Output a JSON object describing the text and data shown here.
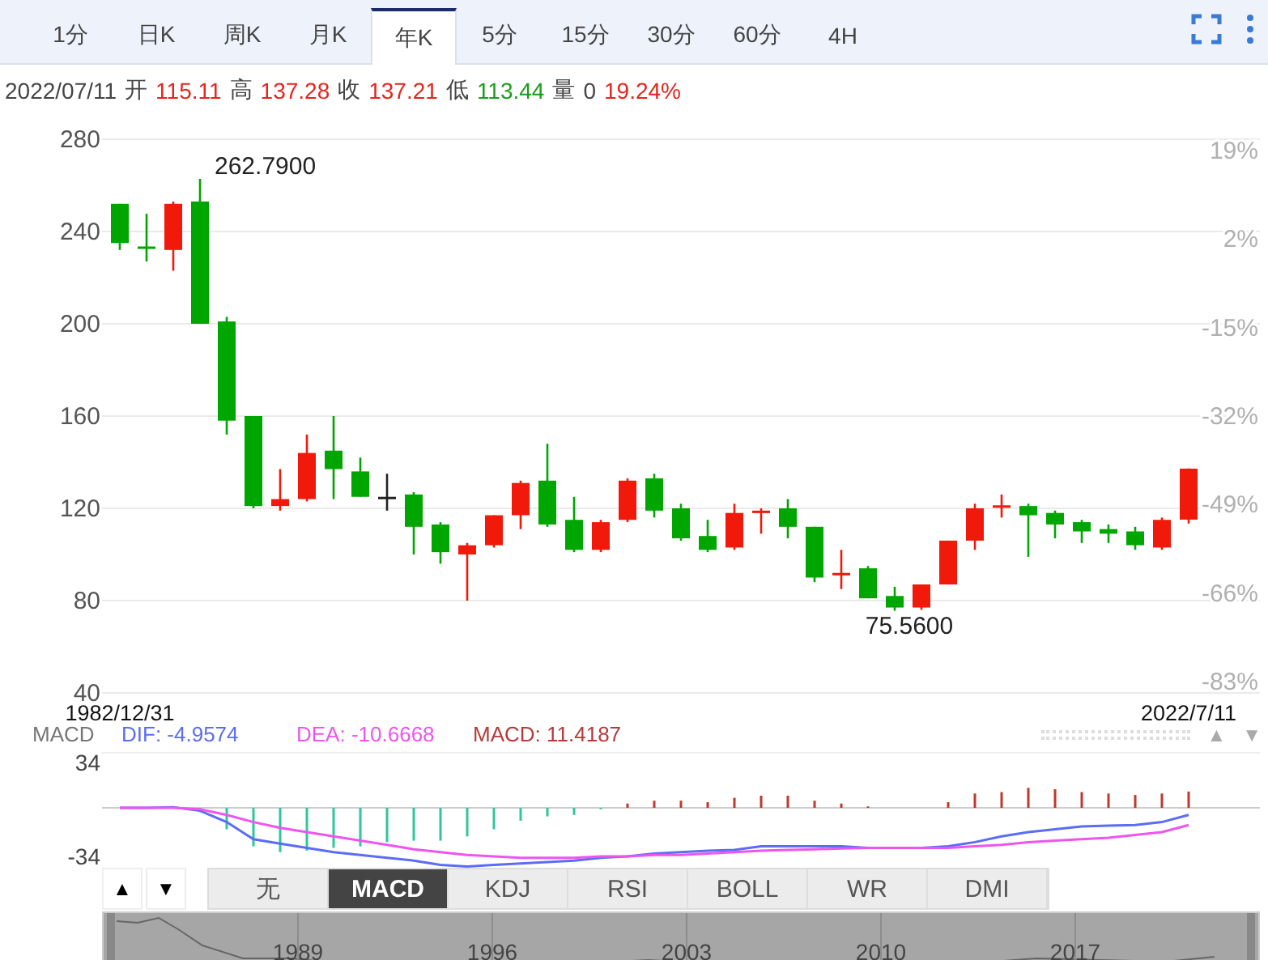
{
  "tabs": [
    {
      "label": "1分",
      "selected": false
    },
    {
      "label": "日K",
      "selected": false
    },
    {
      "label": "周K",
      "selected": false
    },
    {
      "label": "月K",
      "selected": false
    },
    {
      "label": "年K",
      "selected": true
    },
    {
      "label": "5分",
      "selected": false
    },
    {
      "label": "15分",
      "selected": false
    },
    {
      "label": "30分",
      "selected": false
    },
    {
      "label": "60分",
      "selected": false
    },
    {
      "label": "4H",
      "selected": false
    }
  ],
  "quote": {
    "date": "2022/07/11",
    "fields": [
      {
        "label": "开",
        "value": "115.11",
        "color": "#e8231b"
      },
      {
        "label": "高",
        "value": "137.28",
        "color": "#e8231b"
      },
      {
        "label": "收",
        "value": "137.21",
        "color": "#e8231b"
      },
      {
        "label": "低",
        "value": "113.44",
        "color": "#1a9e1a"
      },
      {
        "label": "量",
        "value": "0",
        "color": "#444444"
      }
    ],
    "change": {
      "value": "19.24%",
      "color": "#e8231b"
    }
  },
  "price_chart": {
    "right_axis": [
      "19%",
      "2%",
      "-15%",
      "-32%",
      "-49%",
      "-66%",
      "-83%"
    ],
    "chart_data": {
      "type": "candlestick",
      "categories": [
        "1982/12/31",
        null,
        null,
        null,
        null,
        null,
        null,
        null,
        null,
        null,
        null,
        null,
        null,
        null,
        null,
        null,
        null,
        null,
        null,
        null,
        null,
        null,
        null,
        null,
        null,
        null,
        null,
        null,
        null,
        null,
        null,
        null,
        null,
        null,
        null,
        null,
        null,
        null,
        null,
        null,
        "2022/7/11"
      ],
      "ohlc": [
        [
          252,
          252,
          232,
          235
        ],
        [
          233.5,
          247.7,
          227,
          233
        ],
        [
          232,
          253,
          223,
          252
        ],
        [
          253,
          262.8,
          200,
          200
        ],
        [
          201,
          203,
          152,
          158
        ],
        [
          160,
          160,
          120,
          121
        ],
        [
          121,
          137,
          119,
          124
        ],
        [
          124,
          152,
          123,
          144
        ],
        [
          145,
          160,
          124,
          137
        ],
        [
          136,
          142,
          125,
          125
        ],
        [
          125,
          135,
          119,
          125
        ],
        [
          126,
          127,
          100,
          112
        ],
        [
          113,
          114,
          96,
          101
        ],
        [
          100,
          105,
          80,
          104
        ],
        [
          104,
          117,
          103,
          117
        ],
        [
          117,
          132,
          111,
          131
        ],
        [
          132,
          148,
          112,
          113
        ],
        [
          115,
          125,
          101,
          102
        ],
        [
          102,
          115,
          101,
          114
        ],
        [
          115,
          133,
          114,
          132
        ],
        [
          133,
          135,
          116,
          119
        ],
        [
          120,
          122,
          106,
          107
        ],
        [
          108,
          115,
          101,
          102
        ],
        [
          103,
          122,
          102,
          118
        ],
        [
          118.5,
          120,
          109,
          119
        ],
        [
          120,
          124,
          107,
          112
        ],
        [
          112,
          112,
          88,
          90
        ],
        [
          91.5,
          102,
          85,
          92
        ],
        [
          94,
          95,
          81,
          81
        ],
        [
          82,
          86,
          75.6,
          77
        ],
        [
          77,
          87,
          76,
          87
        ],
        [
          87,
          106,
          87,
          106
        ],
        [
          106,
          122,
          102,
          120
        ],
        [
          121,
          126,
          116,
          121.3
        ],
        [
          121,
          122,
          99,
          117
        ],
        [
          118,
          119,
          107,
          113
        ],
        [
          114,
          115,
          105,
          110
        ],
        [
          111,
          113,
          105,
          109
        ],
        [
          110,
          112,
          102,
          104
        ],
        [
          103,
          116,
          102,
          115
        ],
        [
          115.1,
          137.3,
          113.4,
          137.2
        ]
      ],
      "ylim": [
        40,
        280
      ],
      "yticks": [
        280,
        240,
        200,
        160,
        120,
        80,
        40
      ],
      "grid": true,
      "annotations": [
        "262.7900",
        "75.5600"
      ]
    }
  },
  "macd": {
    "legend": [
      {
        "text": "MACD",
        "kind": "name"
      },
      {
        "text": "DIF: -4.9574",
        "kind": "dif"
      },
      {
        "text": "DEA: -10.6668",
        "kind": "dea"
      },
      {
        "text": "MACD: 11.4187",
        "kind": "macd"
      }
    ],
    "arrows": [
      "▲",
      "▼"
    ],
    "axis": [
      "34",
      "-34"
    ]
  },
  "scroll_buttons": [
    "▲",
    "▼"
  ],
  "indicators": [
    {
      "label": "无",
      "selected": false
    },
    {
      "label": "MACD",
      "selected": true
    },
    {
      "label": "KDJ",
      "selected": false
    },
    {
      "label": "RSI",
      "selected": false
    },
    {
      "label": "BOLL",
      "selected": false
    },
    {
      "label": "WR",
      "selected": false
    },
    {
      "label": "DMI",
      "selected": false
    }
  ],
  "navigator": {
    "years": [
      "1989",
      "1996",
      "2003",
      "2010",
      "2017"
    ]
  }
}
